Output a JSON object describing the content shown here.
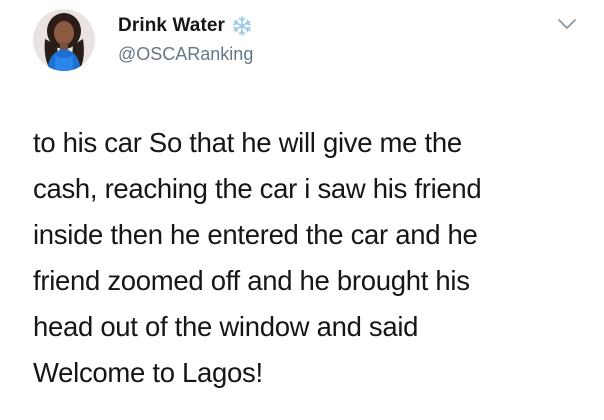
{
  "tweet": {
    "display_name": "Drink Water",
    "handle": "@OSCARanking",
    "badge_icon": "snowflake-icon",
    "menu_icon": "chevron-down-icon",
    "avatar": "avatar",
    "lines": [
      "to his car So that he will give me the",
      "cash, reaching the car i saw his friend",
      "inside then he entered the car and he",
      "friend zoomed off and he brought his",
      "head out of the window and said",
      "Welcome to Lagos!"
    ]
  },
  "colors": {
    "name": "#14171a",
    "handle": "#657786",
    "badge": "#9fc9e8",
    "chevron": "#8899a6"
  }
}
